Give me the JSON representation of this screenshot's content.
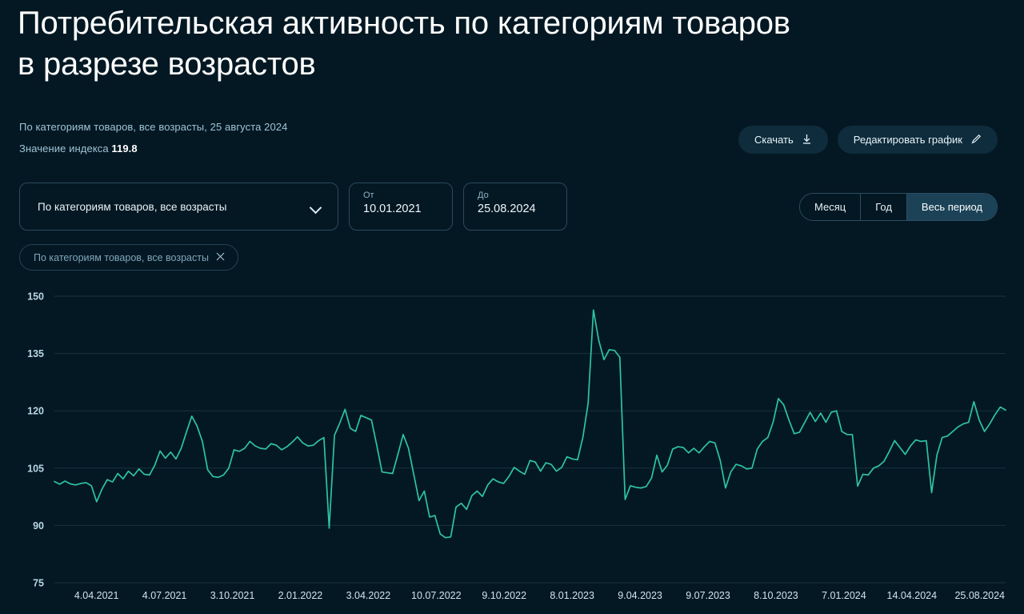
{
  "header": {
    "title": "Потребительская активность по категориям товаров\nв разрезе возрастов",
    "subtitle": "По категориям товаров, все возрасты, 25 августа 2024",
    "index_label": "Значение индекса",
    "index_value": "119.8",
    "download_label": "Скачать",
    "download_icon": "download-icon",
    "edit_label": "Редактировать график",
    "edit_icon": "pencil-icon"
  },
  "controls": {
    "category_select": {
      "value": "По категориям товаров, все возрасты",
      "chevron_icon": "chevron-down-icon"
    },
    "date_from": {
      "label": "От",
      "value": "10.01.2021"
    },
    "date_to": {
      "label": "До",
      "value": "25.08.2024"
    },
    "period": {
      "options": [
        "Месяц",
        "Год",
        "Весь период"
      ],
      "selected": "Весь период"
    },
    "chip": {
      "label": "По категориям товаров, все возрасты",
      "remove_icon": "close-icon"
    }
  },
  "colors": {
    "background": "#041823",
    "line": "#2ec4a0",
    "grid": "#16333f",
    "accent": "#1b4257",
    "muted_text": "#9fc4d6"
  },
  "chart_data": {
    "type": "line",
    "title": "Потребительская активность по категориям товаров в разрезе возрастов",
    "xlabel": "",
    "ylabel": "Значение индекса",
    "ylim": [
      75,
      150
    ],
    "yticks": [
      150,
      135,
      120,
      105,
      90,
      75
    ],
    "grid": true,
    "legend": false,
    "xticks": [
      "4.04.2021",
      "4.07.2021",
      "3.10.2021",
      "2.01.2022",
      "3.04.2022",
      "10.07.2022",
      "9.10.2022",
      "8.01.2023",
      "9.04.2023",
      "9.07.2023",
      "8.10.2023",
      "7.01.2024",
      "14.04.2024",
      "25.08.2024"
    ],
    "series": [
      {
        "name": "По категориям товаров, все возрасты",
        "color": "#2ec4a0",
        "values": [
          101.5,
          100.8,
          101.6,
          100.9,
          100.6,
          101.0,
          101.2,
          100.4,
          96.2,
          99.5,
          102.0,
          101.4,
          103.6,
          102.2,
          104.2,
          103.0,
          104.8,
          103.4,
          103.2,
          105.8,
          109.5,
          107.6,
          109.2,
          107.4,
          110.2,
          114.5,
          118.6,
          116.0,
          112.0,
          104.6,
          102.8,
          102.6,
          103.2,
          105.0,
          109.8,
          109.4,
          110.2,
          112.0,
          110.8,
          110.2,
          110.0,
          111.4,
          111.0,
          109.8,
          110.6,
          111.8,
          113.2,
          111.6,
          110.8,
          111.0,
          112.2,
          113.0,
          89.3,
          113.6,
          116.8,
          120.4,
          115.4,
          114.6,
          118.8,
          118.2,
          117.6,
          111.0,
          104.0,
          103.8,
          103.6,
          108.6,
          113.8,
          110.2,
          103.4,
          96.5,
          99.0,
          92.2,
          92.6,
          87.8,
          86.8,
          87.0,
          94.8,
          95.8,
          94.2,
          97.8,
          99.0,
          97.6,
          100.6,
          102.2,
          101.4,
          101.0,
          102.8,
          105.2,
          104.2,
          103.4,
          107.0,
          106.6,
          104.2,
          106.4,
          106.0,
          104.2,
          105.2,
          108.0,
          107.4,
          107.2,
          113.0,
          122.0,
          146.4,
          138.5,
          133.4,
          136.0,
          135.8,
          134.0,
          96.8,
          100.4,
          100.0,
          99.8,
          100.2,
          102.4,
          108.4,
          104.0,
          105.8,
          110.0,
          110.6,
          110.4,
          109.0,
          110.2,
          109.0,
          110.6,
          112.0,
          111.6,
          107.0,
          99.8,
          104.0,
          106.0,
          105.6,
          104.8,
          105.0,
          110.0,
          112.0,
          113.0,
          117.0,
          123.2,
          121.6,
          117.6,
          114.0,
          114.4,
          117.0,
          119.6,
          117.2,
          119.4,
          117.0,
          119.6,
          120.0,
          114.6,
          113.8,
          113.8,
          100.3,
          103.4,
          103.2,
          105.0,
          105.6,
          106.8,
          109.4,
          112.2,
          110.4,
          108.6,
          110.8,
          112.4,
          112.0,
          112.2,
          98.6,
          108.4,
          113.0,
          113.4,
          114.6,
          115.8,
          116.6,
          117.0,
          122.4,
          117.6,
          114.6,
          116.6,
          119.0,
          121.0,
          120.2
        ]
      }
    ]
  }
}
